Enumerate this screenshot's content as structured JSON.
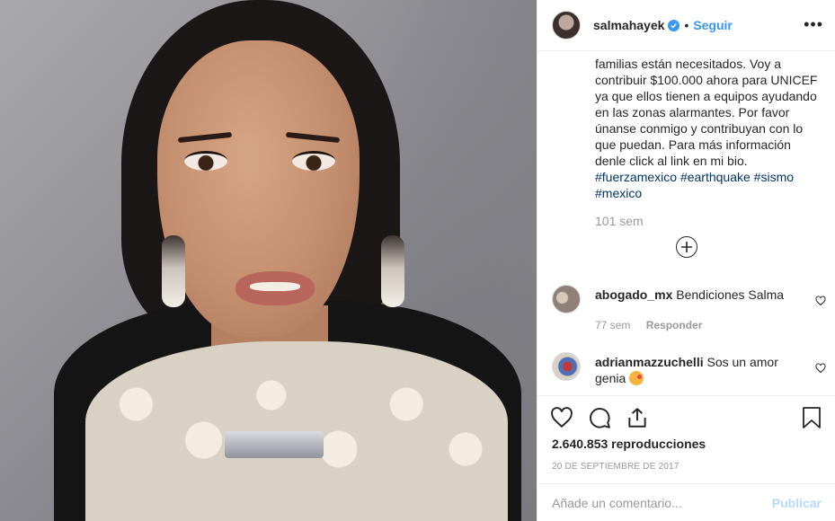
{
  "post": {
    "username": "salmahayek",
    "separator": "•",
    "follow_label": "Seguir",
    "more_label": "•••"
  },
  "caption": {
    "text": "familias están necesitados. Voy a contribuir $100.000 ahora para UNICEF ya que ellos tienen a equipos ayudando en las zonas alarmantes. Por favor únanse conmigo y contribuyan con lo que puedan. Para más información denle click al link en mi bio.",
    "hashtags": [
      "#fuerzamexico",
      "#earthquake",
      "#sismo",
      "#mexico"
    ],
    "time": "101 sem"
  },
  "comments": [
    {
      "user": "abogado_mx",
      "text": "Bendiciones Salma",
      "time": "77 sem",
      "reply_label": "Responder"
    },
    {
      "user": "adrianmazzuchelli",
      "text": "Sos un amor genia",
      "emoji": "face-blowing-kiss"
    }
  ],
  "stats": {
    "views": "2.640.853 reproducciones",
    "date": "20 DE SEPTIEMBRE DE 2017"
  },
  "comment_box": {
    "placeholder": "Añade un comentario...",
    "publish_label": "Publicar"
  },
  "colors": {
    "accent": "#3897f0",
    "hashtag": "#003569",
    "muted": "#999999",
    "publish_disabled": "#b3dbff"
  }
}
